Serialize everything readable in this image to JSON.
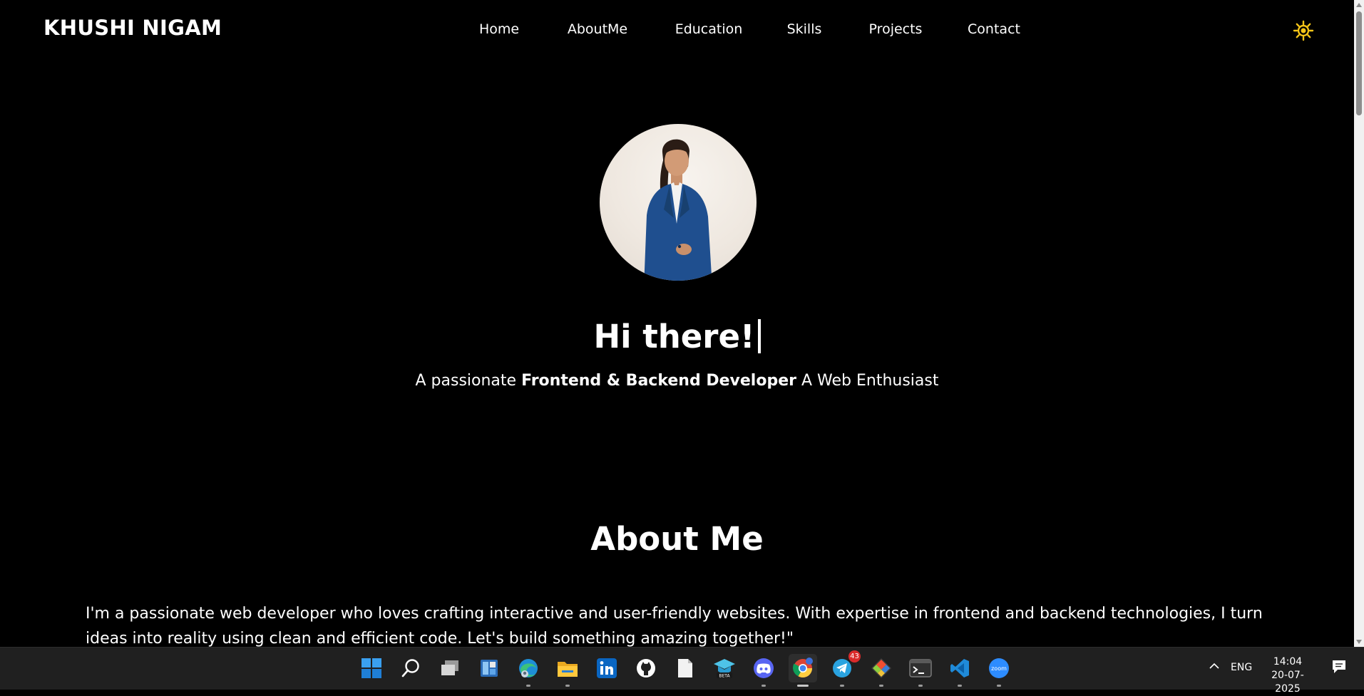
{
  "header": {
    "brand": "KHUSHI NIGAM",
    "nav": [
      "Home",
      "AboutMe",
      "Education",
      "Skills",
      "Projects",
      "Contact"
    ],
    "theme_icon": "sun-icon"
  },
  "hero": {
    "greeting": "Hi there!",
    "tagline_prefix": "A passionate ",
    "tagline_bold": "Frontend & Backend Developer",
    "tagline_suffix": " A Web Enthusiast"
  },
  "about": {
    "heading": "About Me",
    "text": "I'm a passionate web developer who loves crafting interactive and user-friendly websites. With expertise in frontend and backend technologies, I turn ideas into reality using clean and efficient code. Let's build something amazing together!\""
  },
  "colors": {
    "background": "#000000",
    "text": "#ffffff",
    "theme_icon": "#f5c518",
    "taskbar": "#202020"
  },
  "taskbar": {
    "apps": [
      "windows-start-icon",
      "search-icon",
      "task-view-icon",
      "widgets-icon",
      "edge-icon",
      "file-explorer-icon",
      "linkedin-icon",
      "github-icon",
      "notepad-icon",
      "education-beta-icon",
      "discord-icon",
      "chrome-icon",
      "telegram-icon",
      "git-icon",
      "terminal-icon",
      "vscode-icon",
      "zoom-icon"
    ],
    "telegram_badge": "43",
    "zoom_label": "zoom",
    "beta_label": "BETA",
    "language": "ENG",
    "time": "14:04",
    "date": "20-07-2025"
  }
}
